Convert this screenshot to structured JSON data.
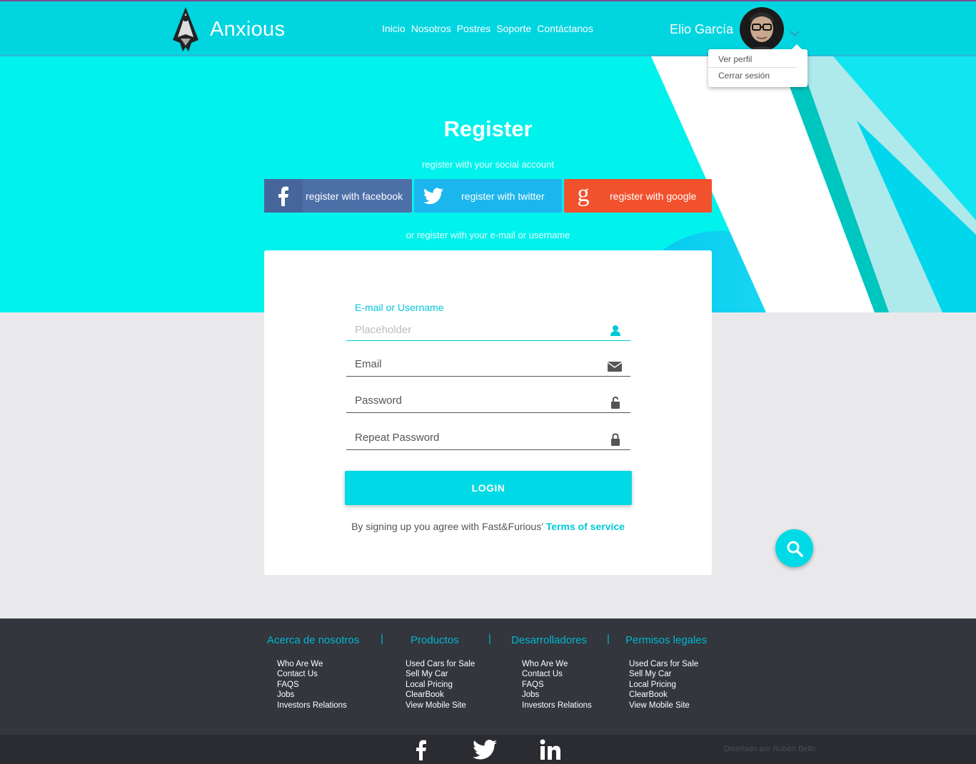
{
  "navbar": {
    "brand": "Anxious",
    "links": [
      "Inicio",
      "Nosotros",
      "Postres",
      "Soporte",
      "Contáctanos"
    ],
    "user_name": "Elio García",
    "dropdown": [
      "Ver perfil",
      "Cerrar sesión"
    ]
  },
  "hero": {
    "title": "Register",
    "social_subtitle": "register with your social account",
    "or_subtitle": "or register with your e-mail or username"
  },
  "social": {
    "facebook": "register with facebook",
    "twitter": "register with twitter",
    "google": "register with google"
  },
  "form": {
    "username_label": "E-mail or Username",
    "username_placeholder": "Placeholder",
    "email_label": "Email",
    "password_label": "Password",
    "repeat_password_label": "Repeat Password",
    "login_label": "LOGIN",
    "terms_text": "By signing up you agree with Fast&Furious’ ",
    "terms_link": "Terms of service"
  },
  "footer": {
    "columns": [
      {
        "title": "Acerca de nosotros",
        "items": [
          "Who Are We",
          "Contact Us",
          "FAQS",
          "Jobs",
          "Investors Relations"
        ]
      },
      {
        "title": "Productos",
        "items": [
          "Used Cars for Sale",
          "Sell My Car",
          "Local Pricing",
          "ClearBook",
          "View Mobile Site"
        ]
      },
      {
        "title": "Desarrolladores",
        "items": [
          "Who Are We",
          "Contact Us",
          "FAQS",
          "Jobs",
          "Investors Relations"
        ]
      },
      {
        "title": "Permisos legales",
        "items": [
          "Used Cars for Sale",
          "Sell My Car",
          "Local Pricing",
          "ClearBook",
          "View Mobile Site"
        ]
      }
    ],
    "separator": "|",
    "designer": "Diseñado por Rubén Bello"
  },
  "colors": {
    "accent": "#00dae6",
    "hero_bg": "#00f2ec",
    "facebook": "#4d6fa8",
    "twitter": "#1cb6ee",
    "google": "#f2512e",
    "footer_bg": "#33363d"
  },
  "icons": {
    "brand": "arrowhead-logo-icon",
    "user_field": "user-icon",
    "email_field": "envelope-icon",
    "password_field": "unlock-icon",
    "repeat_password_field": "lock-icon",
    "fab": "search-icon"
  }
}
